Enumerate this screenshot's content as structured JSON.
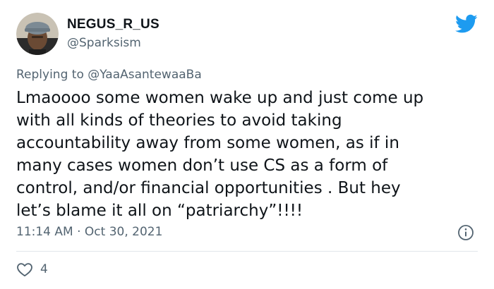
{
  "user": {
    "display_name": "NEGUS_R_US",
    "handle": "@Sparksism",
    "avatar_icon": "profile-photo"
  },
  "tweet": {
    "reply_prefix": "Replying to",
    "reply_to": "@YaaAsantewaaBa",
    "text_lines": [
      "Lmaoooo some women wake up and just come up",
      "with all kinds of theories to avoid taking",
      "accountability away from some women, as if in",
      "many cases women don’t use CS as a form of",
      "control, and/or financial opportunities . But hey",
      "let’s blame it all on “patriarchy”!!!!"
    ],
    "time": "11:14 AM",
    "separator": "·",
    "date": "Oct 30, 2021",
    "like_count": "4"
  },
  "icons": {
    "brand": "twitter-bird-icon",
    "info": "info-icon",
    "like": "heart-icon"
  },
  "colors": {
    "brand": "#1d9bf0",
    "text": "#0f1419",
    "muted": "#536471"
  }
}
